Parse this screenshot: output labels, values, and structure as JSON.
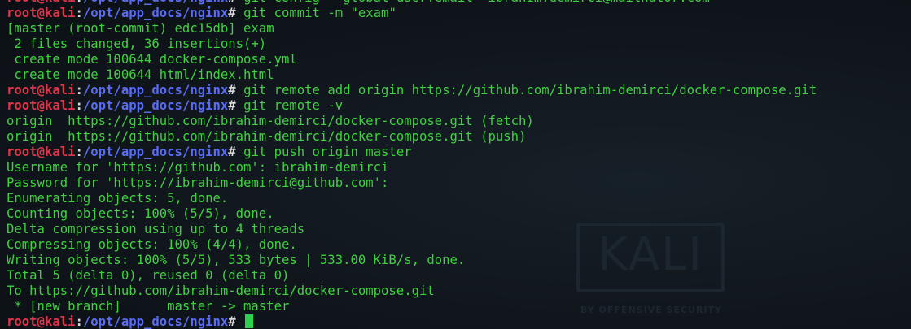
{
  "prompt": {
    "user": "root@kali",
    "sep": ":",
    "path": "/opt/app_docs/nginx",
    "symbol": "# "
  },
  "watermark": {
    "logo": "KALI",
    "tagline": "BY OFFENSIVE SECURITY"
  },
  "lines": [
    {
      "type": "cmd",
      "text": "git config --global user.email \"ibrahim.demirci@mailnator.com\""
    },
    {
      "type": "cmd",
      "text": "git commit -m \"exam\""
    },
    {
      "type": "out",
      "text": "[master (root-commit) edc15db] exam"
    },
    {
      "type": "out",
      "text": " 2 files changed, 36 insertions(+)"
    },
    {
      "type": "out",
      "text": " create mode 100644 docker-compose.yml"
    },
    {
      "type": "out",
      "text": " create mode 100644 html/index.html"
    },
    {
      "type": "cmd",
      "text": "git remote add origin https://github.com/ibrahim-demirci/docker-compose.git"
    },
    {
      "type": "cmd",
      "text": "git remote -v"
    },
    {
      "type": "out",
      "text": "origin  https://github.com/ibrahim-demirci/docker-compose.git (fetch)"
    },
    {
      "type": "out",
      "text": "origin  https://github.com/ibrahim-demirci/docker-compose.git (push)"
    },
    {
      "type": "cmd",
      "text": "git push origin master"
    },
    {
      "type": "out",
      "text": "Username for 'https://github.com': ibrahim-demirci"
    },
    {
      "type": "out",
      "text": "Password for 'https://ibrahim-demirci@github.com':"
    },
    {
      "type": "out",
      "text": "Enumerating objects: 5, done."
    },
    {
      "type": "out",
      "text": "Counting objects: 100% (5/5), done."
    },
    {
      "type": "out",
      "text": "Delta compression using up to 4 threads"
    },
    {
      "type": "out",
      "text": "Compressing objects: 100% (4/4), done."
    },
    {
      "type": "out",
      "text": "Writing objects: 100% (5/5), 533 bytes | 533.00 KiB/s, done."
    },
    {
      "type": "out",
      "text": "Total 5 (delta 0), reused 0 (delta 0)"
    },
    {
      "type": "out",
      "text": "To https://github.com/ibrahim-demirci/docker-compose.git"
    },
    {
      "type": "out",
      "text": " * [new branch]      master -> master"
    },
    {
      "type": "prompt",
      "text": ""
    }
  ]
}
